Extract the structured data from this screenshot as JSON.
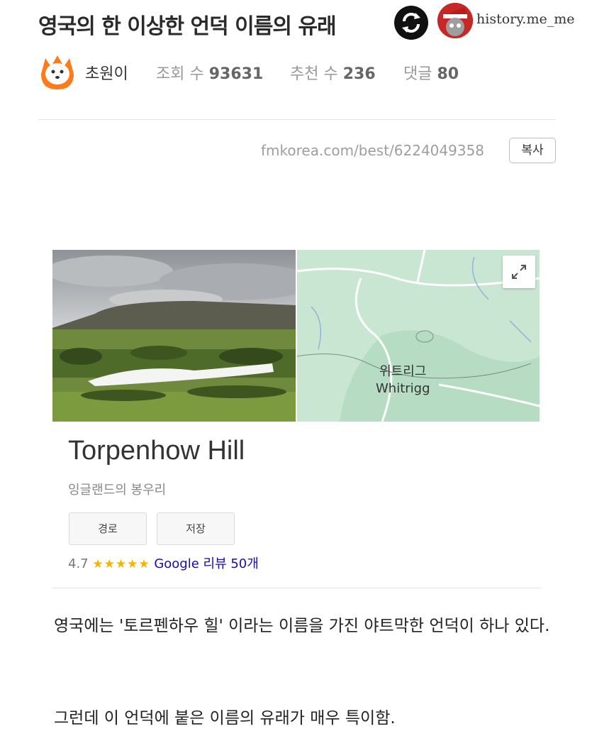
{
  "post": {
    "title": "영국의 한 이상한 언덕 이름의 유래",
    "channel_name": "history.me_me",
    "author": "초원이",
    "views_label": "조회 수",
    "views_value": "93631",
    "recommend_label": "추천 수",
    "recommend_value": "236",
    "comments_label": "댓글",
    "comments_value": "80",
    "url": "fmkorea.com/best/6224049358",
    "copy_label": "복사"
  },
  "card": {
    "map_label_ko": "위트리그",
    "map_label_en": "Whitrigg",
    "place_title": "Torpenhow Hill",
    "place_subtitle": "잉글랜드의 봉우리",
    "route_button": "경로",
    "save_button": "저장",
    "rating": "4.7",
    "stars": "★★★★★",
    "reviews_label": "Google 리뷰 50개"
  },
  "body": {
    "paragraph_1": "영국에는 '토르펜하우 힐' 이라는 이름을 가진 야트막한 언덕이 하나 있다.",
    "paragraph_2": "그런데 이 언덕에 붙은 이름의 유래가 매우 특이함."
  },
  "colors": {
    "star": "#f5b400",
    "link": "#1a0dab",
    "map_bg": "#c9e6d3"
  },
  "icons": [
    "repost-icon",
    "channel-avatar",
    "author-avatar",
    "expand-icon",
    "star-icon"
  ]
}
